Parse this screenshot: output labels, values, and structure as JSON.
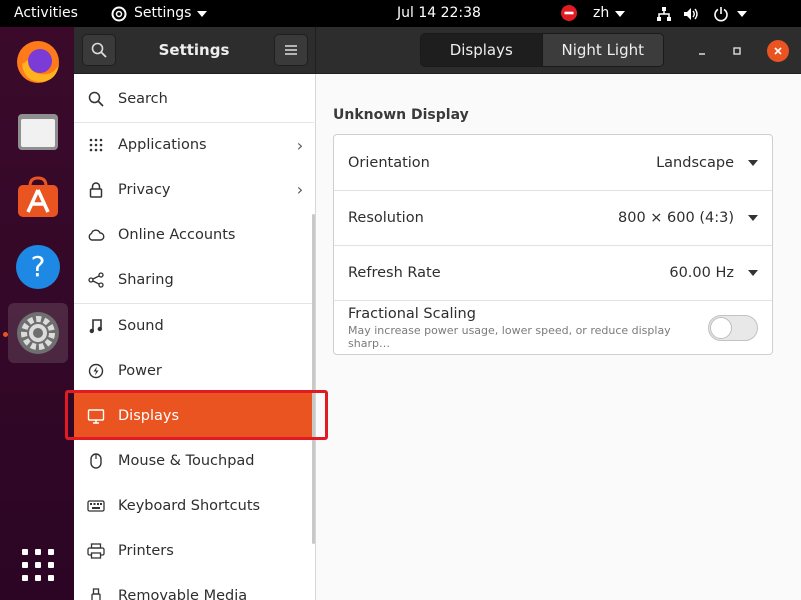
{
  "topbar": {
    "activities": "Activities",
    "app_menu": "Settings",
    "clock": "Jul 14  22:38",
    "input_method": "zh"
  },
  "dock": {
    "apps": [
      "firefox-icon",
      "files-icon",
      "software-icon",
      "help-icon",
      "settings-icon",
      "show-apps-icon"
    ]
  },
  "header": {
    "title": "Settings",
    "view_switcher": {
      "displays": "Displays",
      "night_light": "Night Light"
    }
  },
  "sidebar": {
    "items": [
      {
        "label": "Search",
        "icon": "search-icon"
      },
      {
        "label": "Applications",
        "icon": "grid-icon",
        "has_arrow": true
      },
      {
        "label": "Privacy",
        "icon": "lock-icon",
        "has_arrow": true
      },
      {
        "label": "Online Accounts",
        "icon": "cloud-icon"
      },
      {
        "label": "Sharing",
        "icon": "share-icon"
      },
      {
        "label": "Sound",
        "icon": "music-note-icon"
      },
      {
        "label": "Power",
        "icon": "power-icon"
      },
      {
        "label": "Displays",
        "icon": "display-icon",
        "selected": true
      },
      {
        "label": "Mouse & Touchpad",
        "icon": "mouse-icon"
      },
      {
        "label": "Keyboard Shortcuts",
        "icon": "keyboard-icon"
      },
      {
        "label": "Printers",
        "icon": "printer-icon"
      },
      {
        "label": "Removable Media",
        "icon": "usb-icon"
      }
    ]
  },
  "content": {
    "display_name": "Unknown Display",
    "orientation": {
      "label": "Orientation",
      "value": "Landscape"
    },
    "resolution": {
      "label": "Resolution",
      "value": "800 × 600 (4:3)"
    },
    "refresh_rate": {
      "label": "Refresh Rate",
      "value": "60.00 Hz"
    },
    "fractional_scaling": {
      "label": "Fractional Scaling",
      "description": "May increase power usage, lower speed, or reduce display sharp…",
      "enabled": false
    }
  },
  "colors": {
    "accent": "#e95420",
    "highlight_frame": "#e01b24"
  }
}
